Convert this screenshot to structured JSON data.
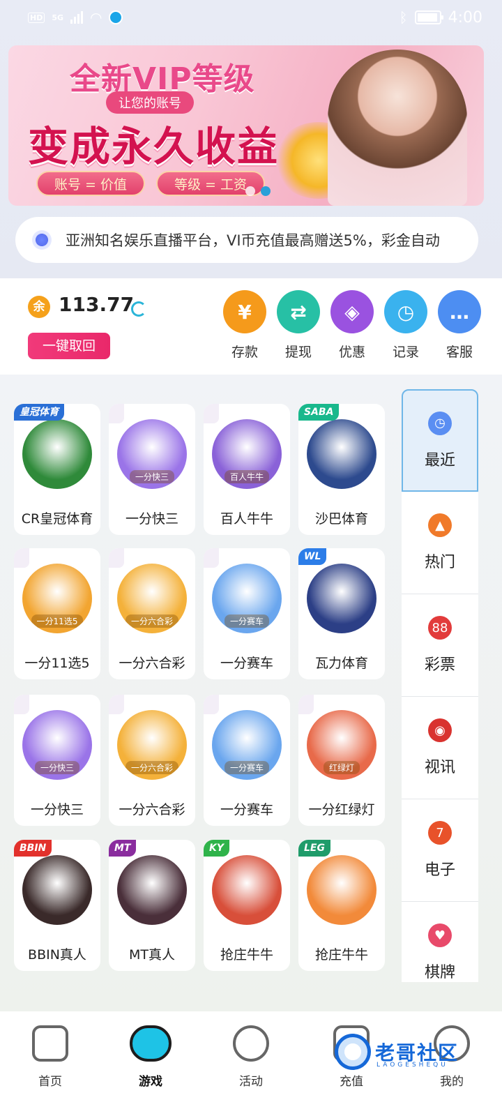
{
  "status_bar": {
    "left_chip": "HD",
    "network": "5G",
    "time": "4:00",
    "icons": [
      "signal-icon",
      "wifi-icon",
      "bluetooth-icon",
      "battery-icon"
    ]
  },
  "banner": {
    "title": "全新VIP等级",
    "subtitle": "让您的账号",
    "main": "变成永久收益",
    "pill1": "账号 = 价值",
    "pill2": "等级 = 工资"
  },
  "notice": {
    "text": "亚洲知名娱乐直播平台，VI币充值最高赠送5%，彩金自动"
  },
  "wallet": {
    "coin_label": "余",
    "balance": "113.77",
    "recall_label": "一键取回",
    "actions": [
      {
        "label": "存款",
        "glyph": "¥",
        "color": "#f59a1b",
        "icon": "yuan-icon"
      },
      {
        "label": "提现",
        "glyph": "⇄",
        "color": "#27c0a5",
        "icon": "transfer-icon"
      },
      {
        "label": "优惠",
        "glyph": "◈",
        "color": "#9a52e0",
        "icon": "tag-icon"
      },
      {
        "label": "记录",
        "glyph": "◷",
        "color": "#3ab2ee",
        "icon": "clock-icon"
      },
      {
        "label": "客服",
        "glyph": "…",
        "color": "#4d8ef2",
        "icon": "chat-icon"
      }
    ]
  },
  "games": [
    {
      "name": "CR皇冠体育",
      "tag": "皇冠体育",
      "tag_color": "#2a6fd6",
      "bg": "#2f8a3a"
    },
    {
      "name": "一分快三",
      "tag": "",
      "avatar_text": "一分快三",
      "bg": "#9a74e8"
    },
    {
      "name": "百人牛牛",
      "tag": "",
      "avatar_text": "百人牛牛",
      "bg": "#8a62d8"
    },
    {
      "name": "沙巴体育",
      "tag": "SABA",
      "tag_color": "#19b88c",
      "bg": "#2d4a8e"
    },
    {
      "name": "一分11选5",
      "tag": "",
      "avatar_text": "一分11选5",
      "bg": "#f2a531"
    },
    {
      "name": "一分六合彩",
      "tag": "",
      "avatar_text": "一分六合彩",
      "bg": "#f4b13a"
    },
    {
      "name": "一分赛车",
      "tag": "",
      "avatar_text": "一分赛车",
      "bg": "#6aa6ee"
    },
    {
      "name": "瓦力体育",
      "tag": "WL",
      "tag_color": "#2c7de8",
      "bg": "#2c3f86"
    },
    {
      "name": "一分快三",
      "tag": "",
      "avatar_text": "一分快三",
      "bg": "#9a74e8"
    },
    {
      "name": "一分六合彩",
      "tag": "",
      "avatar_text": "一分六合彩",
      "bg": "#f4b13a"
    },
    {
      "name": "一分赛车",
      "tag": "",
      "avatar_text": "一分赛车",
      "bg": "#6aa6ee"
    },
    {
      "name": "一分红绿灯",
      "tag": "",
      "avatar_text": "红绿灯",
      "bg": "#e86a4a"
    },
    {
      "name": "BBIN真人",
      "tag": "BBIN",
      "tag_color": "#e2312c",
      "bg": "#3a2a2a"
    },
    {
      "name": "MT真人",
      "tag": "MT",
      "tag_color": "#8a2d9e",
      "bg": "#4a2f3a"
    },
    {
      "name": "抢庄牛牛",
      "tag": "KY",
      "tag_color": "#2fb34a",
      "bg": "#d84f3a"
    },
    {
      "name": "抢庄牛牛",
      "tag": "LEG",
      "tag_color": "#1f9c6a",
      "bg": "#f28a3a"
    }
  ],
  "sidebar": [
    {
      "label": "最近",
      "icon": "clock-icon",
      "color": "#5a8ef2",
      "glyph": "◷"
    },
    {
      "label": "热门",
      "icon": "fire-icon",
      "color": "#f07a2a",
      "glyph": "▲"
    },
    {
      "label": "彩票",
      "icon": "lottery-ball-icon",
      "color": "#e23b3b",
      "glyph": "88"
    },
    {
      "label": "视讯",
      "icon": "poker-chip-icon",
      "color": "#d9332f",
      "glyph": "◉"
    },
    {
      "label": "电子",
      "icon": "slot-seven-icon",
      "color": "#e8522a",
      "glyph": "7"
    },
    {
      "label": "棋牌",
      "icon": "cards-icon",
      "color": "#e84a6a",
      "glyph": "♥"
    }
  ],
  "bottom_nav": [
    {
      "label": "首页",
      "icon": "home-icon",
      "active": false
    },
    {
      "label": "游戏",
      "icon": "gamepad-icon",
      "active": true
    },
    {
      "label": "活动",
      "icon": "flag-icon",
      "active": false
    },
    {
      "label": "充值",
      "icon": "wallet-icon",
      "active": false
    },
    {
      "label": "我的",
      "icon": "user-icon",
      "active": false
    }
  ],
  "watermark": {
    "text": "老哥社区",
    "sub": "LAOGESHEQU"
  }
}
